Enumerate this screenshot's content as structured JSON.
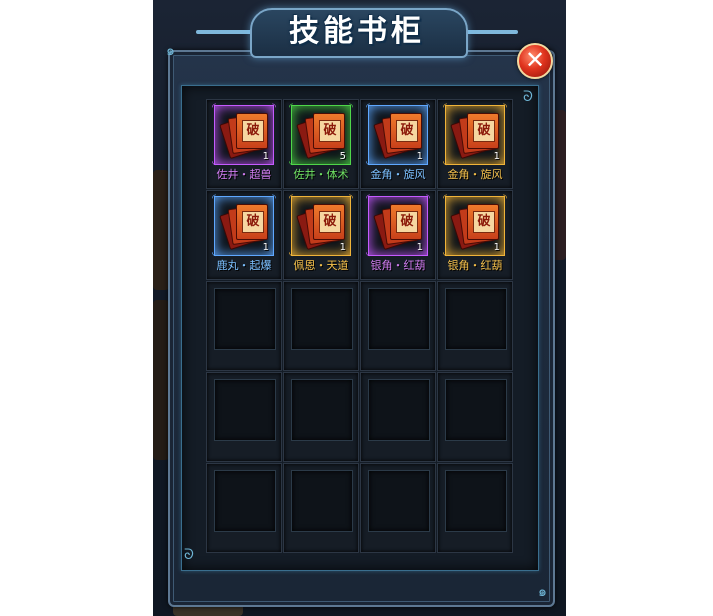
{
  "window": {
    "title": "技能书柜",
    "close_icon": "close-icon",
    "accent_color": "#6fb6d6"
  },
  "rarity_colors": {
    "purple": "#c55bff",
    "green": "#4fd64a",
    "blue": "#5fa8ff",
    "gold": "#f0b43a"
  },
  "name_colors": {
    "purple": "#d07cf0",
    "green": "#6fe063",
    "blue": "#7cc0ff",
    "gold": "#f5c04a"
  },
  "items": [
    {
      "name": "佐井・超兽",
      "count": "1",
      "rarity": "purple",
      "icon": "skill-book-icon",
      "glyph": "破"
    },
    {
      "name": "佐井・体术",
      "count": "5",
      "rarity": "green",
      "icon": "skill-book-icon",
      "glyph": "破"
    },
    {
      "name": "金角・旋风",
      "count": "1",
      "rarity": "blue",
      "icon": "skill-book-icon",
      "glyph": "破"
    },
    {
      "name": "金角・旋风",
      "count": "1",
      "rarity": "gold",
      "icon": "skill-book-icon",
      "glyph": "破"
    },
    {
      "name": "鹿丸・起爆",
      "count": "1",
      "rarity": "blue",
      "icon": "skill-book-icon",
      "glyph": "破"
    },
    {
      "name": "佩恩・天道",
      "count": "1",
      "rarity": "gold",
      "icon": "skill-book-icon",
      "glyph": "破"
    },
    {
      "name": "银角・红葫",
      "count": "1",
      "rarity": "purple",
      "icon": "skill-book-icon",
      "glyph": "破"
    },
    {
      "name": "银角・红葫",
      "count": "1",
      "rarity": "gold",
      "icon": "skill-book-icon",
      "glyph": "破"
    }
  ],
  "empty_slot_count": 12
}
